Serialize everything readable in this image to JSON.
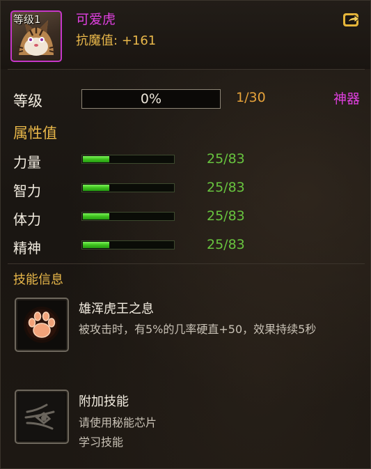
{
  "header": {
    "avatar_level": "等级1",
    "pet_name": "可爱虎",
    "resist_label": "抗魔值:",
    "resist_value": "+161",
    "share_icon": "share-icon",
    "avatar_border_color": "#c637c9"
  },
  "level": {
    "label": "等级",
    "percent_text": "0%",
    "percent": 0,
    "count": "1/30",
    "artifact_label": "神器"
  },
  "attributes": {
    "title": "属性值",
    "stats": [
      {
        "label": "力量",
        "value": "25/83",
        "fraction": 0.3
      },
      {
        "label": "智力",
        "value": "25/83",
        "fraction": 0.3
      },
      {
        "label": "体力",
        "value": "25/83",
        "fraction": 0.3
      },
      {
        "label": "精神",
        "value": "25/83",
        "fraction": 0.3
      }
    ]
  },
  "skills": {
    "title": "技能信息",
    "items": [
      {
        "icon": "paw-icon",
        "name": "雄浑虎王之息",
        "desc": [
          "被攻击时，有5%的几率硬直+50，效果持续5秒"
        ]
      },
      {
        "icon": "claw-emblem-icon",
        "name": "附加技能",
        "desc": [
          "请使用秘能芯片",
          "学习技能"
        ]
      }
    ]
  },
  "colors": {
    "name_magenta": "#e040e0",
    "gold": "#e9b84a",
    "orange": "#e6a23a",
    "green_value": "#68c43f"
  }
}
